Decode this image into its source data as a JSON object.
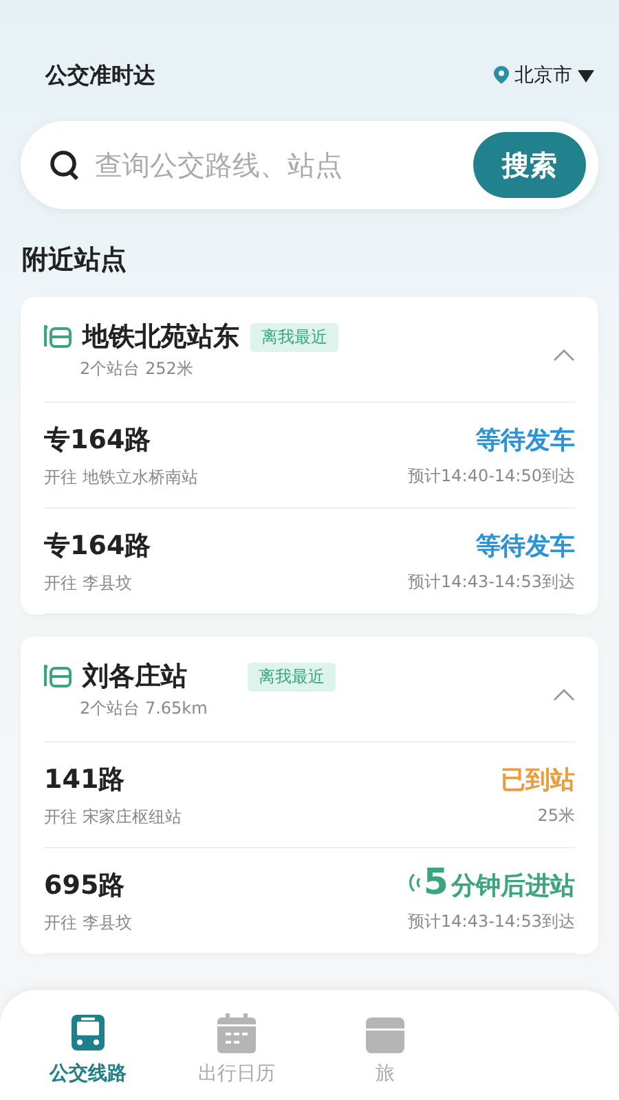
{
  "header": {
    "title": "公交准时达",
    "city": "北京市"
  },
  "search": {
    "placeholder": "查询公交路线、站点",
    "button": "搜索"
  },
  "section_title": "附近站点",
  "stations": [
    {
      "name": "地铁北苑站东",
      "tag": "离我最近",
      "info": "2个站台 252米",
      "expanded": true,
      "routes": [
        {
          "line": "专164路",
          "direction": "开往 地铁立水桥南站",
          "kind": "waiting",
          "status": "等待发车",
          "detail": "预计14:40-14:50到达"
        },
        {
          "line": "专164路",
          "direction": "开往 李县坟",
          "kind": "waiting",
          "status": "等待发车",
          "detail": "预计14:43-14:53到达"
        }
      ]
    },
    {
      "name": "刘各庄站",
      "tag": "离我最近",
      "info": "2个站台 7.65km",
      "expanded": true,
      "routes": [
        {
          "line": "141路",
          "direction": "开往 宋家庄枢纽站",
          "kind": "arrived",
          "status": "已到站",
          "detail": "25米"
        },
        {
          "line": "695路",
          "direction": "开往 李县坟",
          "kind": "coming",
          "count": "5",
          "status": "分钟后进站",
          "detail": "预计14:43-14:53到达"
        }
      ]
    }
  ],
  "tabs": [
    {
      "label": "公交线路",
      "kind": "bus",
      "selected": true
    },
    {
      "label": "出行日历",
      "kind": "calendar",
      "selected": false
    },
    {
      "label": "旅",
      "kind": "box",
      "selected": false
    }
  ]
}
